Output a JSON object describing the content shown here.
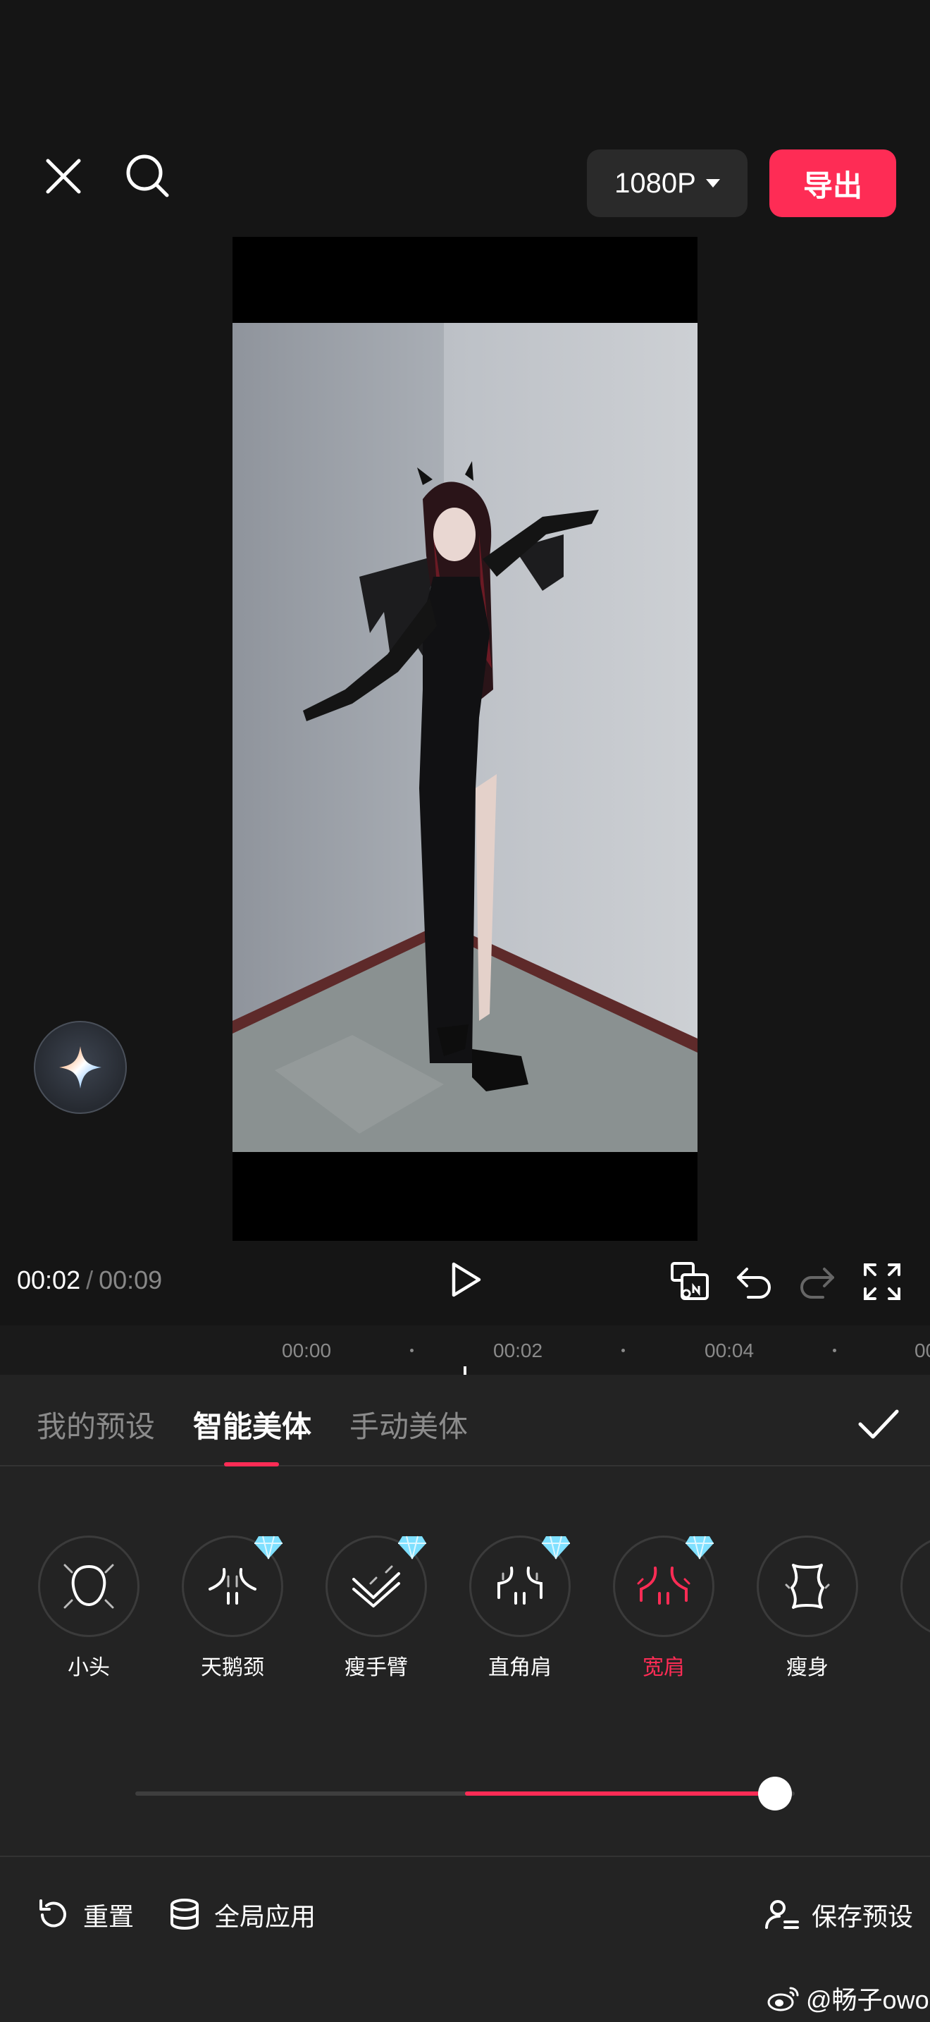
{
  "header": {
    "resolution_label": "1080P",
    "export_label": "导出"
  },
  "player": {
    "current_time": "00:02",
    "separator": "/",
    "total_time": "00:09"
  },
  "timeline": {
    "ticks": [
      "00:00",
      "00:02",
      "00:04",
      "00"
    ]
  },
  "tabs": [
    {
      "label": "我的预设",
      "active": false
    },
    {
      "label": "智能美体",
      "active": true
    },
    {
      "label": "手动美体",
      "active": false
    }
  ],
  "tools": [
    {
      "label": "小头",
      "icon": "small-head-icon",
      "premium": false,
      "marked": true
    },
    {
      "label": "天鹅颈",
      "icon": "swan-neck-icon",
      "premium": true,
      "marked": false
    },
    {
      "label": "瘦手臂",
      "icon": "slim-arm-icon",
      "premium": true,
      "marked": false
    },
    {
      "label": "直角肩",
      "icon": "square-shoulder-icon",
      "premium": true,
      "marked": false
    },
    {
      "label": "宽肩",
      "icon": "wide-shoulder-icon",
      "premium": true,
      "marked": true,
      "active": true
    },
    {
      "label": "瘦身",
      "icon": "slim-body-icon",
      "premium": false,
      "marked": false
    }
  ],
  "slider": {
    "value_fraction": 0.97
  },
  "actions": {
    "reset_label": "重置",
    "apply_all_label": "全局应用",
    "save_preset_label": "保存预设"
  },
  "watermark": {
    "text": "@畅子owo"
  },
  "colors": {
    "accent": "#fe2c55",
    "background": "#151515",
    "panel": "#232323"
  }
}
